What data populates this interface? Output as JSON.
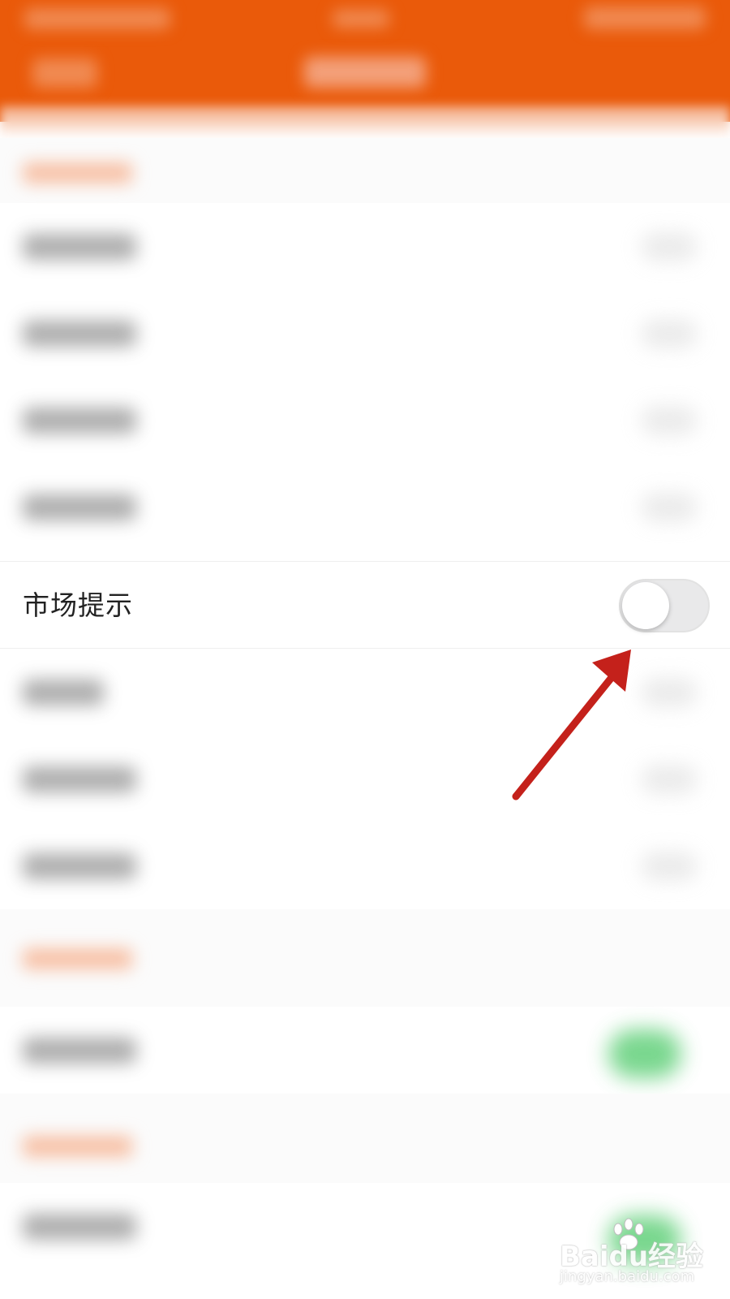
{
  "setting_row": {
    "label": "市场提示",
    "toggle_on": false
  },
  "watermark": {
    "brand": "Baidu经验",
    "url": "jingyan.baidu.com"
  },
  "colors": {
    "header": "#ea5a0a",
    "annotation_arrow": "#c4211b",
    "toggle_on": "#58cd72",
    "toggle_off": "#e9e9ea"
  }
}
